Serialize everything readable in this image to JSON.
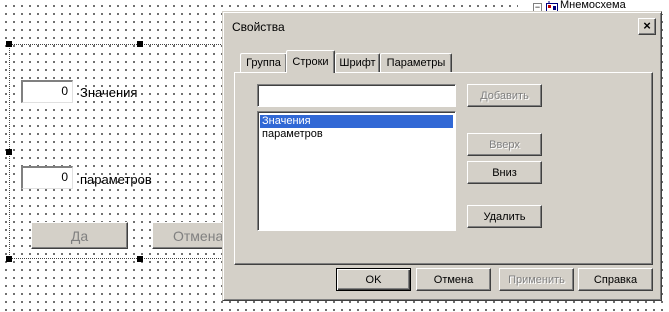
{
  "canvas": {
    "field1_value": "0",
    "field1_label": "Значения",
    "field2_value": "0",
    "field2_label": "параметров",
    "yes_button": "Да",
    "cancel_button_partial": "Отмена"
  },
  "tree": {
    "toggle": "−",
    "item_label": "Мнемосхема",
    "icon": "mnemo-diagram-icon"
  },
  "dialog": {
    "title": "Свойства",
    "close_glyph": "×",
    "tabs": [
      "Группа",
      "Строки",
      "Шрифт",
      "Параметры"
    ],
    "active_tab": "Строки",
    "input_value": "",
    "list_items": [
      "Значения",
      "параметров"
    ],
    "selected_item": "Значения",
    "buttons": {
      "add": "Добавить",
      "up": "Вверх",
      "down": "Вниз",
      "delete": "Удалить",
      "ok": "OK",
      "cancel": "Отмена",
      "apply": "Применить",
      "help": "Справка"
    }
  },
  "colors": {
    "selection": "#3168d5",
    "face": "#d4d0c8"
  }
}
